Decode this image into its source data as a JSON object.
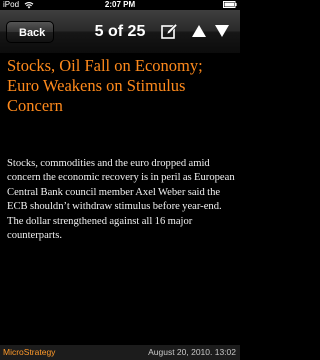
{
  "status_bar": {
    "carrier": "iPod",
    "time": "2:07 PM"
  },
  "nav": {
    "back_label": "Back",
    "position": "5 of 25",
    "icons": [
      "edit-icon",
      "previous-arrow-icon",
      "next-arrow-icon"
    ]
  },
  "article": {
    "headline": "Stocks, Oil Fall on Economy; Euro Weakens on Stimulus Concern",
    "body": "Stocks, commodities and the euro dropped amid concern the economic recovery is in peril as European Central Bank council member Axel Weber said the ECB shouldn’t withdraw stimulus before year-end. The dollar strengthened against all 16 major counterparts."
  },
  "footer": {
    "source": "MicroStrategy",
    "timestamp": "August 20, 2010. 13:02"
  },
  "colors": {
    "headline": "#ff8a1c",
    "source": "#ff9a2a",
    "background": "#000000"
  }
}
